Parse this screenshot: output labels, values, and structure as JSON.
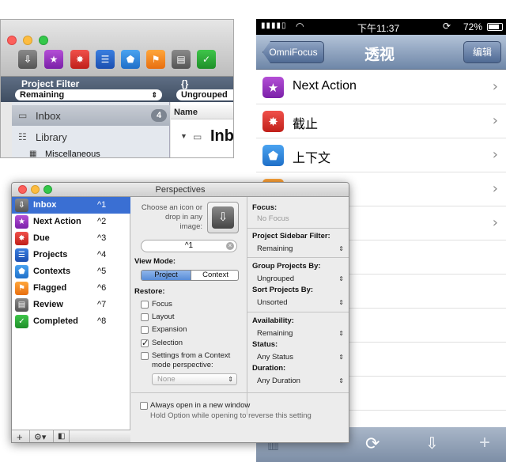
{
  "mac_window": {
    "project_filter_label": "Project Filter",
    "project_filter_value": "Remaining",
    "grouping_label": "{} Grouping",
    "grouping_value": "Ungrouped",
    "inbox_label": "Inbox",
    "inbox_count": "4",
    "library_label": "Library",
    "misc_label": "Miscellaneous",
    "name_column": "Name",
    "outline_title": "Inb"
  },
  "ios": {
    "time": "下午11:37",
    "battery": "72%",
    "back_button": "OmniFocus",
    "nav_title": "透视",
    "edit_button": "编辑",
    "rows": [
      {
        "label": "Next Action",
        "icon": "star-icon"
      },
      {
        "label": "截止",
        "icon": "due-icon"
      },
      {
        "label": "上下文",
        "icon": "context-tag-icon"
      },
      {
        "label": "",
        "icon": "flag-icon"
      },
      {
        "label": "",
        "icon": "blank"
      }
    ]
  },
  "perspectives": {
    "title": "Perspectives",
    "items": [
      {
        "name": "Inbox",
        "key": "^1"
      },
      {
        "name": "Next Action",
        "key": "^2"
      },
      {
        "name": "Due",
        "key": "^3"
      },
      {
        "name": "Projects",
        "key": "^4"
      },
      {
        "name": "Contexts",
        "key": "^5"
      },
      {
        "name": "Flagged",
        "key": "^6"
      },
      {
        "name": "Review",
        "key": "^7"
      },
      {
        "name": "Completed",
        "key": "^8"
      }
    ],
    "icon_hint": "Choose an icon or drop in any image:",
    "shortcut_value": "^1",
    "view_mode_label": "View Mode:",
    "view_mode_project": "Project",
    "view_mode_context": "Context",
    "restore_label": "Restore:",
    "restore_focus": "Focus",
    "restore_layout": "Layout",
    "restore_expansion": "Expansion",
    "restore_selection": "Selection",
    "restore_settings": "Settings from a Context mode perspective:",
    "settings_popup": "None",
    "always_open": "Always open in a new window",
    "hold_option": "Hold Option while opening to reverse this setting",
    "focus_label": "Focus:",
    "focus_value": "No Focus",
    "sidebar_filter_label": "Project Sidebar Filter:",
    "sidebar_filter_value": "Remaining",
    "group_label": "Group Projects By:",
    "group_value": "Ungrouped",
    "sort_label": "Sort Projects By:",
    "sort_value": "Unsorted",
    "availability_label": "Availability:",
    "availability_value": "Remaining",
    "status_label": "Status:",
    "status_value": "Any Status",
    "duration_label": "Duration:",
    "duration_value": "Any Duration"
  }
}
